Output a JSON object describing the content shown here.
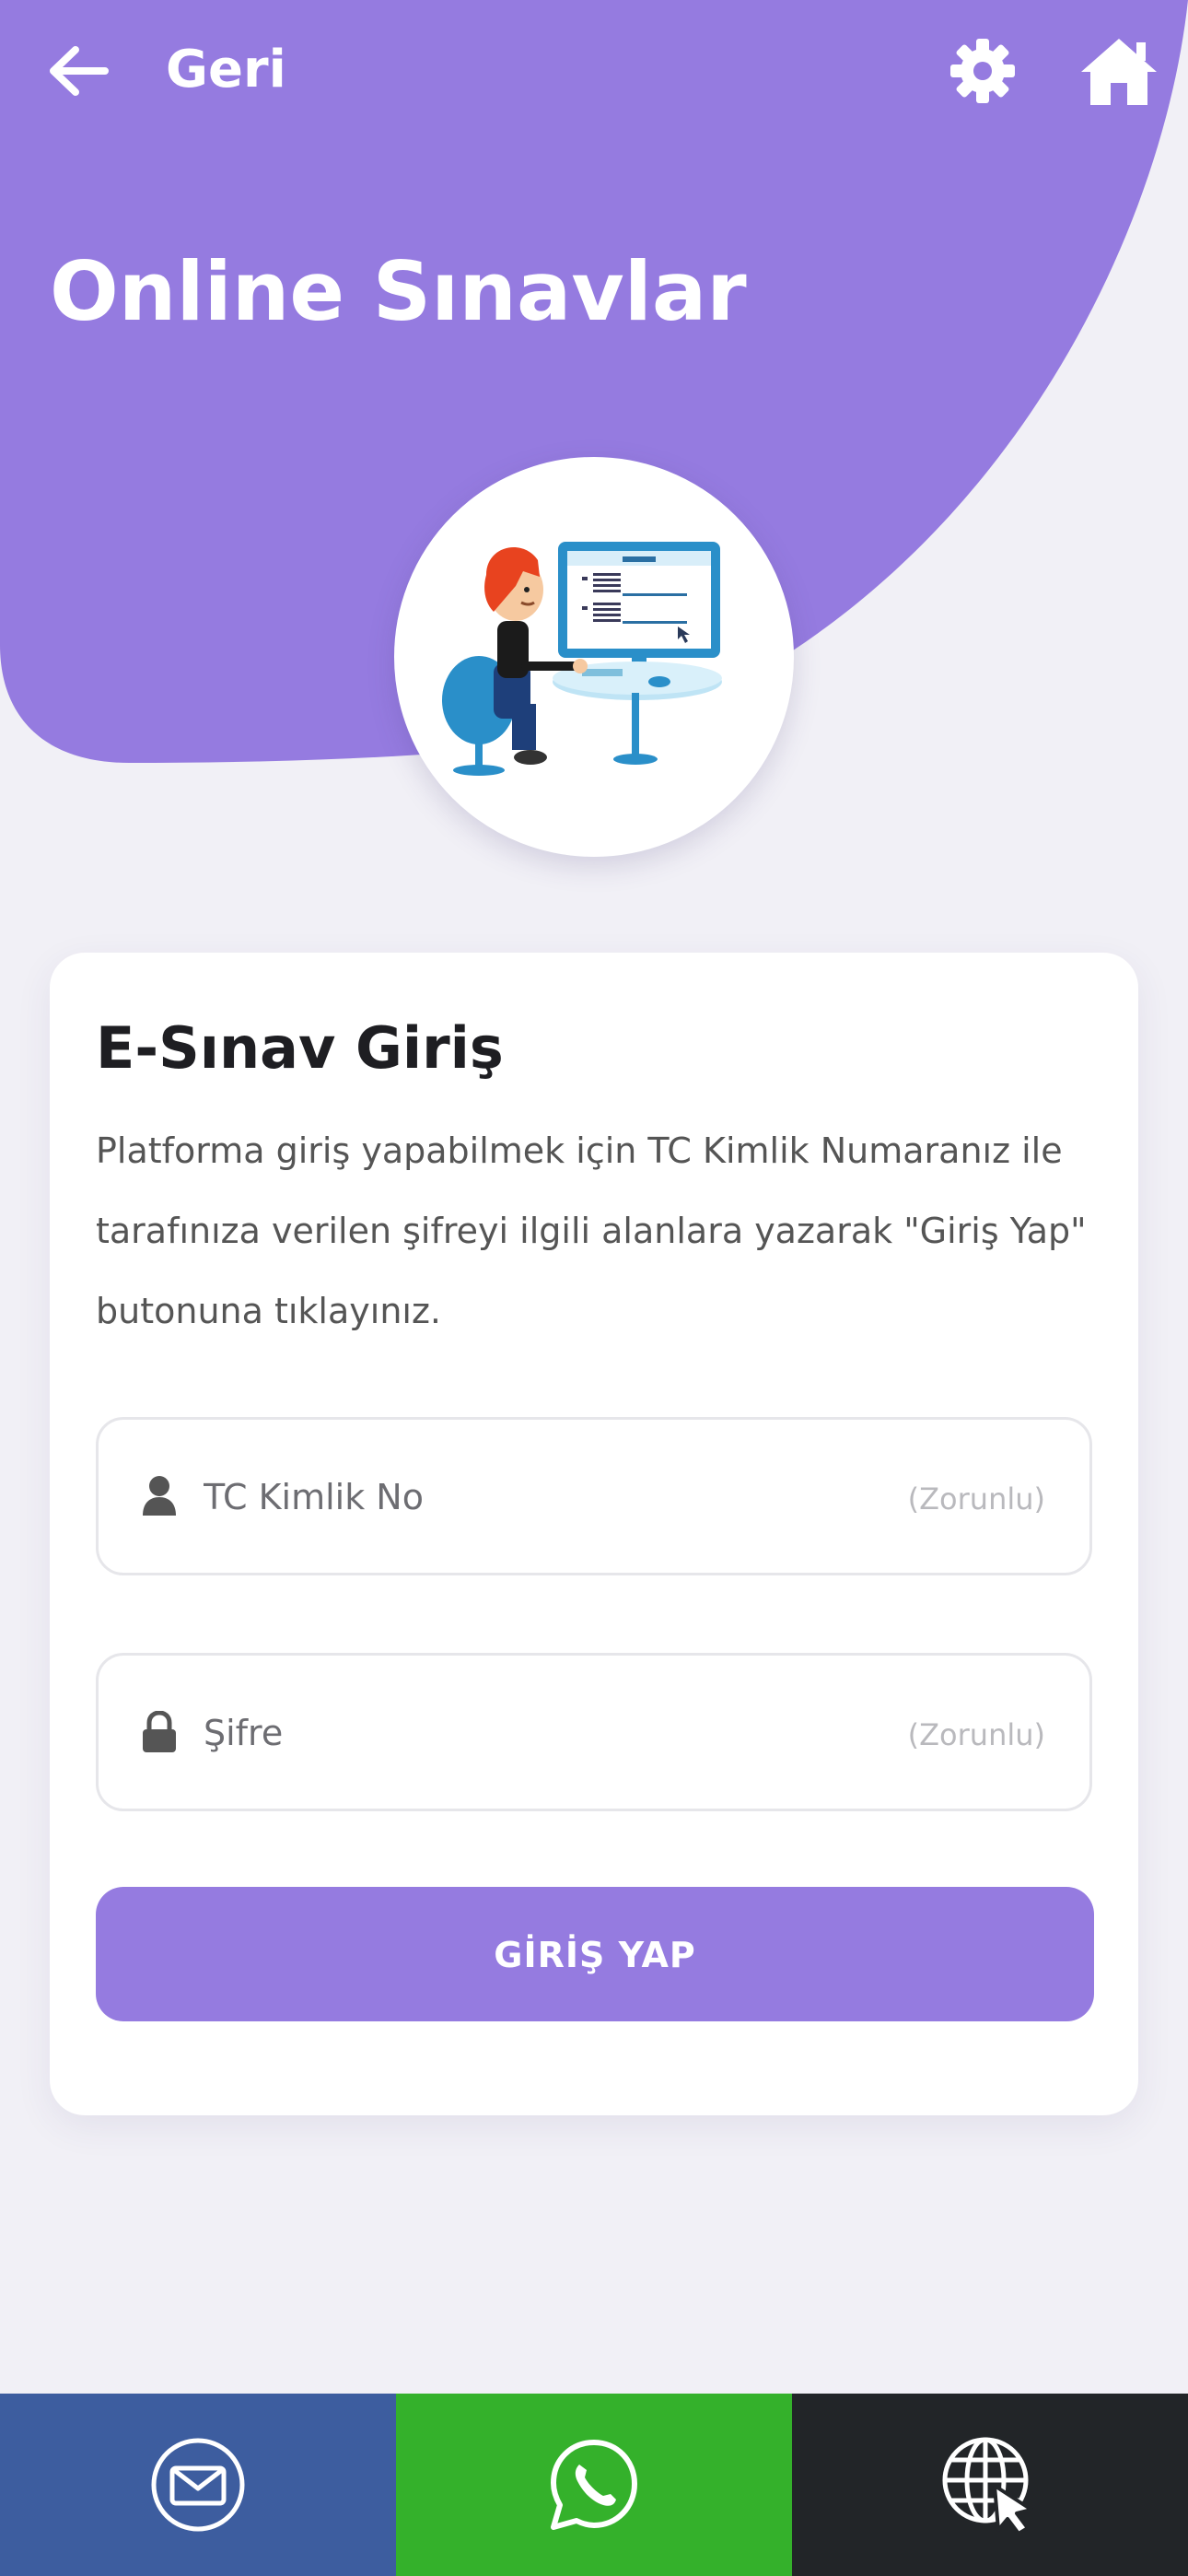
{
  "colors": {
    "header_purple": "#957be0",
    "page_bg": "#f1f0f6",
    "button_purple": "#957be0",
    "mail_bg": "#3d5d9f",
    "whatsapp_bg": "#34b12b",
    "web_bg": "#222528"
  },
  "topbar": {
    "back_label": "Geri",
    "icons": [
      "back-arrow-icon",
      "gear-icon",
      "home-icon"
    ]
  },
  "header": {
    "title": "Online Sınavlar",
    "illustration": "quiz-computer-illustration"
  },
  "login_card": {
    "title": "E-Sınav Giriş",
    "description": "Platforma giriş yapabilmek için TC Kimlik Numaranız ile tarafınıza verilen şifreyi ilgili alanlara yazarak \"Giriş Yap\" butonuna tıklayınız.",
    "tc_field": {
      "placeholder": "TC Kimlik No",
      "value": "",
      "required_label": "(Zorunlu)",
      "icon": "user-icon"
    },
    "password_field": {
      "placeholder": "Şifre",
      "value": "",
      "required_label": "(Zorunlu)",
      "icon": "lock-icon"
    },
    "submit_label": "GİRİŞ YAP"
  },
  "bottom_bar": {
    "items": [
      {
        "icon": "mail-icon"
      },
      {
        "icon": "whatsapp-icon"
      },
      {
        "icon": "globe-cursor-icon"
      }
    ]
  }
}
